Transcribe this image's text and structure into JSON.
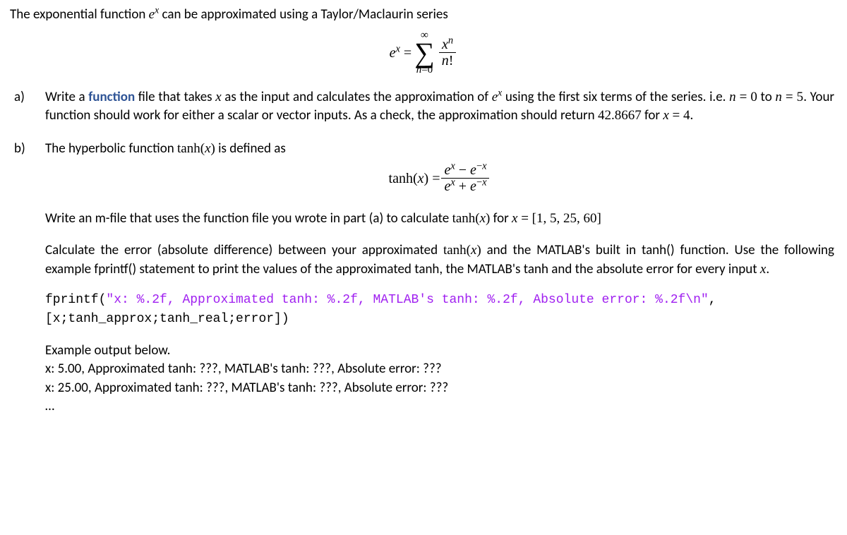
{
  "intro": {
    "prefix": "The exponential function ",
    "func": "e",
    "funcSup": "x",
    "suffix": " can be approximated using a Taylor/Maclaurin series"
  },
  "eq1": {
    "lhs_e": "e",
    "lhs_sup": "x",
    "equals": " = ",
    "sum_top": "∞",
    "sum_sigma": "∑",
    "sum_bottom_var": "n",
    "sum_bottom_eq": "=",
    "sum_bottom_val": "0",
    "numer_base": "x",
    "numer_sup": "n",
    "denom_var": "n",
    "denom_excl": "!"
  },
  "a": {
    "label": "a)",
    "t1": "Write a ",
    "func_word": "function",
    "t2": " file that takes ",
    "x": "x",
    "t3": " as the input and calculates the approximation of ",
    "e": "e",
    "eSup": "x",
    "t4": " using the first six terms of the series. i.e. ",
    "n0": "n = 0",
    "t5": " to ",
    "n5": "n = 5",
    "t6": ". Your function should work for either a scalar or vector inputs. As a check, the approximation should return ",
    "val": "42.8667",
    "t7": " for ",
    "x4": "x = 4",
    "t8": "."
  },
  "b": {
    "label": "b)",
    "intro_prefix": "The hyperbolic function ",
    "intro_tanh": "tanh(x)",
    "intro_suffix": " is defined as",
    "eq": {
      "lhs": "tanh(x)",
      "equals": " = ",
      "n1_e": "e",
      "n1_sup": "x",
      "minus": " − ",
      "n2_e": "e",
      "n2_sup": "−x",
      "d1_e": "e",
      "d1_sup": "x",
      "plus": " + ",
      "d2_e": "e",
      "d2_sup": "−x"
    },
    "p1": {
      "t1": "Write an m-file that uses the function file you wrote in part (a) to calculate ",
      "tanh": "tanh(x)",
      "t2": " for ",
      "vec": "x = [1, 5, 25, 60]"
    },
    "p2": {
      "t1": "Calculate the error (absolute difference) between your approximated ",
      "tanh": "tanh(x)",
      "t2": " and the MATLAB's built in tanh() function. Use the following example fprintf() statement to print the values of the approximated tanh, the MATLAB's tanh and the absolute error for every input ",
      "x": "x",
      "t3": "."
    },
    "code": {
      "fn": "fprintf(",
      "str": "\"x: %.2f, Approximated tanh: %.2f, MATLAB's tanh: %.2f, Absolute error: %.2f\\n\"",
      "rest": ",",
      "line2": "[x;tanh_approx;tanh_real;error])"
    },
    "example": {
      "head": "Example output below.",
      "l1": "x: 5.00, Approximated tanh: ???, MATLAB's tanh: ???, Absolute error: ???",
      "l2": "x: 25.00, Approximated tanh: ???, MATLAB's tanh: ???, Absolute error: ???",
      "dots": "…"
    }
  }
}
